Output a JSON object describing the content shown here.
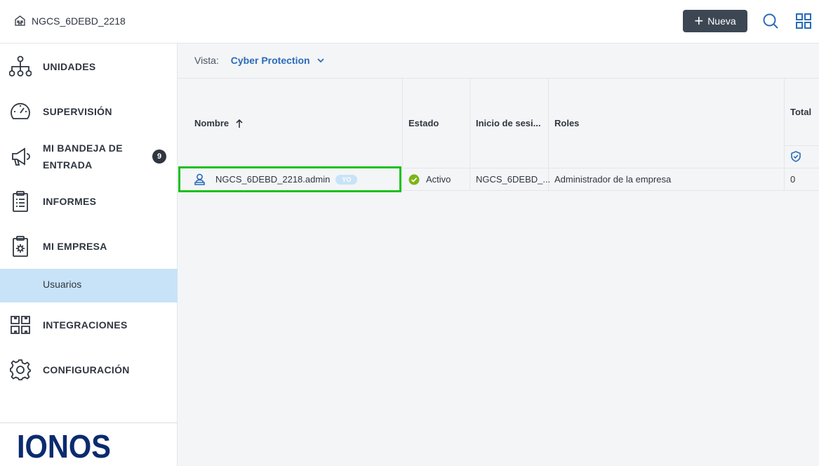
{
  "header": {
    "tenant_name": "NGCS_6DEBD_2218",
    "new_button_label": "Nueva"
  },
  "sidebar": {
    "items": [
      {
        "label": "UNIDADES",
        "icon": "sitemap-icon"
      },
      {
        "label": "SUPERVISIÓN",
        "icon": "gauge-icon"
      },
      {
        "label": "MI BANDEJA DE ENTRADA",
        "label_line1": "MI BANDEJA DE",
        "label_line2": "ENTRADA",
        "icon": "megaphone-icon",
        "badge": "9"
      },
      {
        "label": "INFORMES",
        "icon": "clipboard-report-icon"
      },
      {
        "label": "MI EMPRESA",
        "icon": "company-settings-icon"
      },
      {
        "label": "INTEGRACIONES",
        "icon": "integrations-icon"
      },
      {
        "label": "CONFIGURACIÓN",
        "icon": "gear-icon"
      }
    ],
    "active_sub_item": "Usuarios",
    "logo_text": "IONOS"
  },
  "main": {
    "view_label": "Vista:",
    "view_value": "Cyber Protection",
    "columns": [
      "Nombre",
      "Estado",
      "Inicio de sesi...",
      "Roles",
      "Total"
    ],
    "rows": [
      {
        "name": "NGCS_6DEBD_2218.admin",
        "tag": "YO",
        "status": "Activo",
        "login": "NGCS_6DEBD_...",
        "roles": "Administrador de la empresa",
        "total": "0"
      }
    ]
  },
  "colors": {
    "accent": "#2a6cb8",
    "active_nav_bg": "#c8e3f7",
    "status_active": "#7cb518",
    "highlight": "#18c11a",
    "new_button_bg": "#3d4754"
  }
}
